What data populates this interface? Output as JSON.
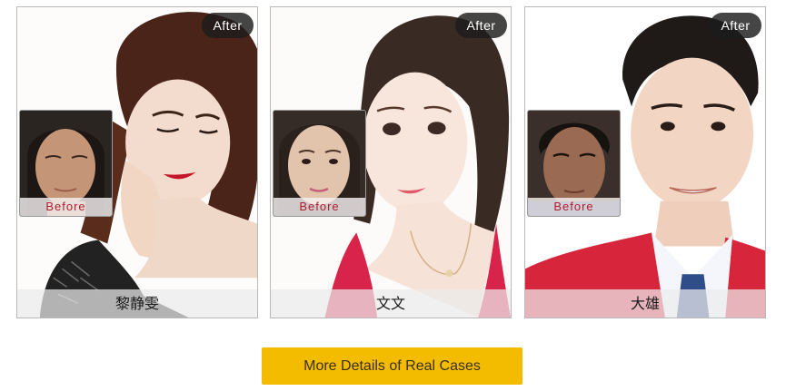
{
  "cases": [
    {
      "after_label": "After",
      "before_label": "Before",
      "name": "黎静雯"
    },
    {
      "after_label": "After",
      "before_label": "Before",
      "name": "文文"
    },
    {
      "after_label": "After",
      "before_label": "Before",
      "name": "大雄"
    }
  ],
  "more_button": {
    "label": "More Details of Real Cases"
  },
  "colors": {
    "button_bg": "#f3bc00",
    "before_text": "#b01e2f",
    "after_badge_bg": "#1c1c1c",
    "card_border": "#b9b9b9"
  }
}
